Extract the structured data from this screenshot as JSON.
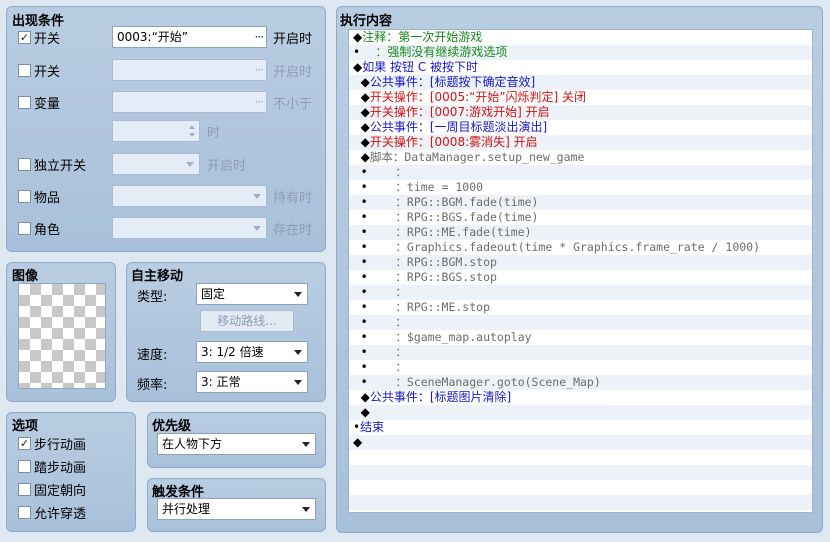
{
  "conditions": {
    "title": "出现条件",
    "switch1": {
      "label": "开关",
      "checked": true,
      "value": "0003:“开始”",
      "suffix": "开启时"
    },
    "switch2": {
      "label": "开关",
      "checked": false,
      "value": "",
      "suffix": "开启时"
    },
    "variable": {
      "label": "变量",
      "checked": false,
      "value": "",
      "suffix": "不小于",
      "spin_suffix": "时"
    },
    "self_switch": {
      "label": "独立开关",
      "checked": false,
      "value": "",
      "suffix": "开启时"
    },
    "item": {
      "label": "物品",
      "checked": false,
      "value": "",
      "suffix": "持有时"
    },
    "actor": {
      "label": "角色",
      "checked": false,
      "value": "",
      "suffix": "存在时"
    }
  },
  "image": {
    "title": "图像"
  },
  "autonomous": {
    "title": "自主移动",
    "type_label": "类型:",
    "type_value": "固定",
    "route_button": "移动路线...",
    "speed_label": "速度:",
    "speed_value": "3: 1/2 倍速",
    "freq_label": "频率:",
    "freq_value": "3: 正常"
  },
  "options": {
    "title": "选项",
    "items": [
      {
        "label": "步行动画",
        "checked": true
      },
      {
        "label": "踏步动画",
        "checked": false
      },
      {
        "label": "固定朝向",
        "checked": false
      },
      {
        "label": "允许穿透",
        "checked": false
      }
    ]
  },
  "priority": {
    "title": "优先级",
    "value": "在人物下方"
  },
  "trigger": {
    "title": "触发条件",
    "value": "并行处理"
  },
  "contents": {
    "title": "执行内容",
    "rows": [
      {
        "prefix": "◆",
        "text": "注释：第一次开始游戏",
        "color": "green",
        "mono": false
      },
      {
        "prefix": "•",
        "text": "    ：强制没有继续游戏选项",
        "color": "green",
        "mono": false
      },
      {
        "prefix": "◆",
        "text": "如果 按钮 C 被按下时",
        "color": "blue",
        "mono": false
      },
      {
        "prefix": "  ◆",
        "text": "公共事件：[标题按下确定音效]",
        "color": "blue",
        "mono": false
      },
      {
        "prefix": "  ◆",
        "text": "开关操作：[0005:“开始”闪烁判定] 关闭",
        "color": "red",
        "mono": false
      },
      {
        "prefix": "  ◆",
        "text": "开关操作：[0007:游戏开始] 开启",
        "color": "red",
        "mono": false
      },
      {
        "prefix": "  ◆",
        "text": "公共事件：[一周目标题淡出演出]",
        "color": "blue",
        "mono": false
      },
      {
        "prefix": "  ◆",
        "text": "开关操作：[0008:雾消失] 开启",
        "color": "red",
        "mono": false
      },
      {
        "prefix": "  ◆",
        "text": "脚本：DataManager.setup_new_game",
        "color": "gray",
        "mono": true
      },
      {
        "prefix": "  •",
        "text": "    ：",
        "color": "gray",
        "mono": true
      },
      {
        "prefix": "  •",
        "text": "    ：time = 1000",
        "color": "gray",
        "mono": true
      },
      {
        "prefix": "  •",
        "text": "    ：RPG::BGM.fade(time)",
        "color": "gray",
        "mono": true
      },
      {
        "prefix": "  •",
        "text": "    ：RPG::BGS.fade(time)",
        "color": "gray",
        "mono": true
      },
      {
        "prefix": "  •",
        "text": "    ：RPG::ME.fade(time)",
        "color": "gray",
        "mono": true
      },
      {
        "prefix": "  •",
        "text": "    ：Graphics.fadeout(time * Graphics.frame_rate / 1000)",
        "color": "gray",
        "mono": true
      },
      {
        "prefix": "  •",
        "text": "    ：RPG::BGM.stop",
        "color": "gray",
        "mono": true
      },
      {
        "prefix": "  •",
        "text": "    ：RPG::BGS.stop",
        "color": "gray",
        "mono": true
      },
      {
        "prefix": "  •",
        "text": "    ：",
        "color": "gray",
        "mono": true
      },
      {
        "prefix": "  •",
        "text": "    ：RPG::ME.stop",
        "color": "gray",
        "mono": true
      },
      {
        "prefix": "  •",
        "text": "    ：",
        "color": "gray",
        "mono": true
      },
      {
        "prefix": "  •",
        "text": "    ：$game_map.autoplay",
        "color": "gray",
        "mono": true
      },
      {
        "prefix": "  •",
        "text": "    ：",
        "color": "gray",
        "mono": true
      },
      {
        "prefix": "  •",
        "text": "    ：",
        "color": "gray",
        "mono": true
      },
      {
        "prefix": "  •",
        "text": "    ：SceneManager.goto(Scene_Map)",
        "color": "gray",
        "mono": true
      },
      {
        "prefix": "  ◆",
        "text": "公共事件：[标题图片清除]",
        "color": "blue",
        "mono": false
      },
      {
        "prefix": "  ◆",
        "text": "",
        "color": "black",
        "mono": false
      },
      {
        "prefix": "•",
        "text": "结束",
        "color": "blue",
        "mono": false
      },
      {
        "prefix": "◆",
        "text": "",
        "color": "black",
        "mono": false
      },
      {
        "prefix": "",
        "text": "",
        "color": "black",
        "mono": false
      },
      {
        "prefix": "",
        "text": "",
        "color": "black",
        "mono": false
      },
      {
        "prefix": "",
        "text": "",
        "color": "black",
        "mono": false
      },
      {
        "prefix": "",
        "text": "",
        "color": "black",
        "mono": false
      }
    ]
  }
}
